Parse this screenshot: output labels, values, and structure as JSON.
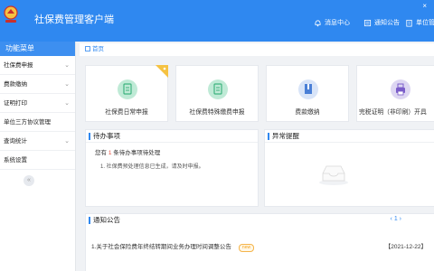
{
  "header": {
    "app_title": "社保费管理客户端",
    "close_glyph": "×",
    "menu": [
      {
        "icon": "bell-icon",
        "label": "消息中心"
      },
      {
        "icon": "notice-icon",
        "label": "通知公告"
      },
      {
        "icon": "building-icon",
        "label": "单位管"
      }
    ]
  },
  "sidebar": {
    "title": "功能菜单",
    "items": [
      {
        "label": "社保费申报",
        "has_children": true
      },
      {
        "label": "费款缴纳",
        "has_children": true
      },
      {
        "label": "证明打印",
        "has_children": true
      },
      {
        "label": "单位三方协议管理",
        "has_children": false
      },
      {
        "label": "查询统计",
        "has_children": true
      },
      {
        "label": "系统设置",
        "has_children": false
      }
    ],
    "collapse_glyph": "«"
  },
  "breadcrumb": {
    "home": "首页"
  },
  "quick_actions": [
    {
      "icon": "clipboard-icon",
      "label": "社保费日常申报",
      "color": "#bfead6"
    },
    {
      "icon": "clipboard-icon",
      "label": "社保费特殊缴费申报",
      "color": "#bfead6"
    },
    {
      "icon": "book-icon",
      "label": "费款缴纳",
      "color": "#d8e4f8"
    },
    {
      "icon": "printer-icon",
      "label": "完税证明（非印刷）开具",
      "color": "#ddd6f2"
    }
  ],
  "todo": {
    "title": "待办事项",
    "summary_prefix": "您有",
    "count": "1",
    "summary_suffix": "条待办事项待处理",
    "items": [
      "1. 社保费预处理信息已生成，请及时申报。"
    ]
  },
  "alerts": {
    "title": "异常提醒"
  },
  "notices": {
    "title": "通知公告",
    "pager": "‹ 1 ›",
    "items": [
      {
        "text": "1.关于社会保险费年终结转期间业务办理时间调整公告",
        "badge": "new",
        "date": "【2021-12-22】"
      }
    ]
  },
  "colors": {
    "primary": "#2f88f0",
    "badge": "#f5a623",
    "count": "#e64b3b"
  }
}
